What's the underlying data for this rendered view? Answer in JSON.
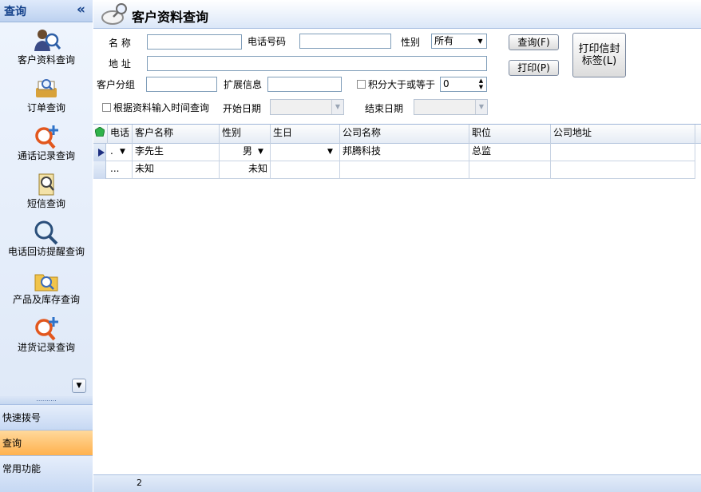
{
  "sidebar": {
    "title": "查询",
    "collapse_glyph": "«",
    "items": [
      {
        "label": "客户资料查询",
        "icon": "customer-search-icon"
      },
      {
        "label": "订单查询",
        "icon": "order-search-icon"
      },
      {
        "label": "通话记录查询",
        "icon": "call-record-search-icon"
      },
      {
        "label": "短信查询",
        "icon": "sms-search-icon"
      },
      {
        "label": "电话回访提醒查询",
        "icon": "callback-reminder-search-icon"
      },
      {
        "label": "产品及库存查询",
        "icon": "product-stock-search-icon"
      },
      {
        "label": "进货记录查询",
        "icon": "purchase-record-search-icon"
      }
    ],
    "dropdown_glyph": "▼",
    "grip": "..........",
    "bottom_buttons": [
      {
        "label": "快速拨号",
        "active": false
      },
      {
        "label": "查询",
        "active": true
      },
      {
        "label": "常用功能",
        "active": false
      }
    ]
  },
  "main": {
    "title": "客户资料查询",
    "title_icon": "magnifier-icon",
    "form": {
      "name_label": "名 称",
      "name_value": "",
      "phone_label": "电话号码",
      "phone_value": "",
      "gender_label": "性别",
      "gender_value": "所有",
      "address_label": "地 址",
      "address_value": "",
      "group_label": "客户分组",
      "group_value": "",
      "ext_label": "扩展信息",
      "ext_value": "",
      "points_label": "积分大于或等于",
      "points_value": "0",
      "by_time_label": "根据资料输入时间查询",
      "start_label": "开始日期",
      "end_label": "结束日期"
    },
    "buttons": {
      "query": "查询(F)",
      "print": "打印(P)",
      "print_label_line1": "打印信封",
      "print_label_line2": "标签(L)"
    },
    "grid": {
      "columns": [
        "电话",
        "客户名称",
        "性别",
        "生日",
        "公司名称",
        "职位",
        "公司地址"
      ],
      "rows": [
        {
          "phone": ".",
          "name": "李先生",
          "gender": "男",
          "birthday": "",
          "company": "邦腾科技",
          "position": "总监",
          "address": ""
        },
        {
          "phone": "...",
          "name": "未知",
          "gender": "未知",
          "birthday": "",
          "company": "",
          "position": "",
          "address": ""
        }
      ]
    },
    "status": {
      "count": "2"
    }
  },
  "colors": {
    "accent": "#15428b",
    "active_tab": "#ffb14d",
    "header_bg": "#dbe7f8"
  }
}
